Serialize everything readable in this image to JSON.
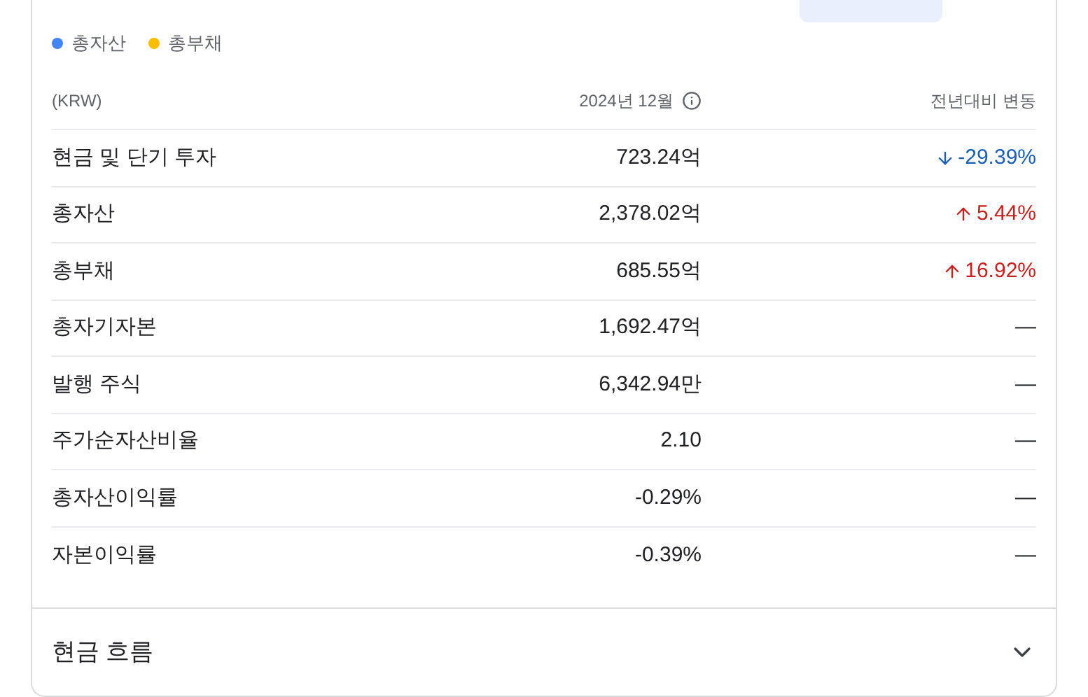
{
  "legend": [
    {
      "label": "총자산",
      "color": "#4285f4"
    },
    {
      "label": "총부채",
      "color": "#fbbc04"
    }
  ],
  "table": {
    "columns": [
      "(KRW)",
      "2024년 12월",
      "전년대비 변동"
    ],
    "rows": [
      {
        "label": "현금 및 단기 투자",
        "value": "723.24억",
        "change": "-29.39%",
        "kind": "down"
      },
      {
        "label": "총자산",
        "value": "2,378.02억",
        "change": "5.44%",
        "kind": "up"
      },
      {
        "label": "총부채",
        "value": "685.55억",
        "change": "16.92%",
        "kind": "up"
      },
      {
        "label": "총자기자본",
        "value": "1,692.47억",
        "change": "—",
        "kind": "none"
      },
      {
        "label": "발행 주식",
        "value": "6,342.94만",
        "change": "—",
        "kind": "none"
      },
      {
        "label": "주가순자산비율",
        "value": "2.10",
        "change": "—",
        "kind": "none"
      },
      {
        "label": "총자산이익률",
        "value": "-0.29%",
        "change": "—",
        "kind": "none"
      },
      {
        "label": "자본이익률",
        "value": "-0.39%",
        "change": "—",
        "kind": "none"
      }
    ]
  },
  "cash_flow": {
    "title": "현금 흐름",
    "expanded": false
  }
}
